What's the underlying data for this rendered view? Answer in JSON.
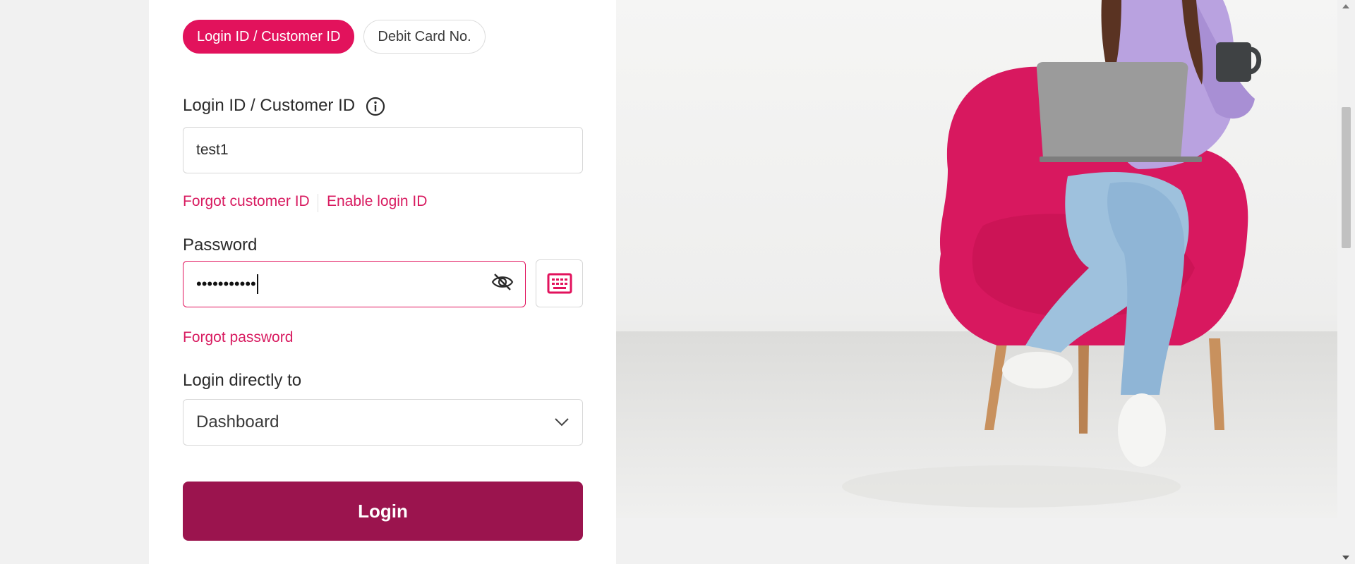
{
  "login_form": {
    "tabs": [
      {
        "label": "Login ID / Customer ID",
        "active": true
      },
      {
        "label": "Debit Card No.",
        "active": false
      }
    ],
    "customer_id": {
      "label": "Login ID / Customer ID",
      "value": "test1",
      "info_icon": "info-icon"
    },
    "links": {
      "forgot_customer_id": "Forgot customer ID",
      "enable_login_id": "Enable login ID",
      "forgot_password": "Forgot password"
    },
    "password": {
      "label": "Password",
      "masked_value": "•••••••••••",
      "visibility_icon": "eye-off-icon",
      "virtual_keyboard_icon": "keyboard-icon"
    },
    "login_directly_to": {
      "label": "Login directly to",
      "selected": "Dashboard",
      "icon": "chevron-down-icon"
    },
    "submit_label": "Login"
  },
  "colors": {
    "accent_pink": "#e2125c",
    "link_pink": "#d81b60",
    "login_button": "#9b144e",
    "chair_pink": "#d8185f",
    "background": "#f1f1f1"
  }
}
